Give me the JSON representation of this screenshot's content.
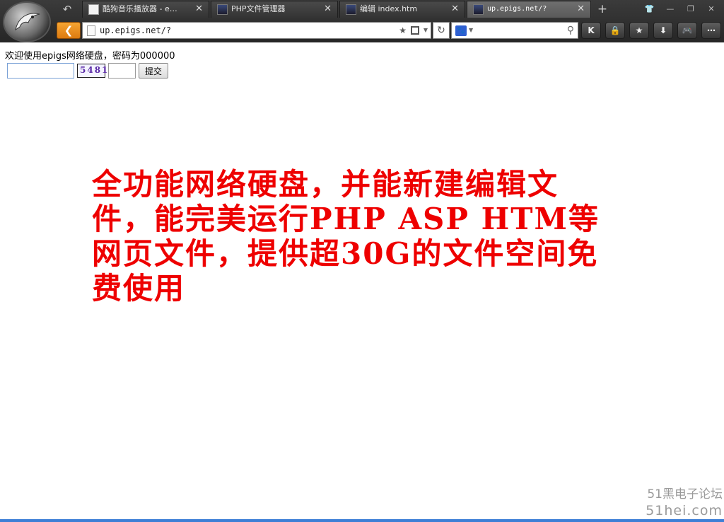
{
  "browser": {
    "tabs": [
      {
        "title": "酷狗音乐播放器 - e…",
        "icon": "document-icon",
        "active": false
      },
      {
        "title": "PHP文件管理器",
        "icon": "user-avatar-icon",
        "active": false
      },
      {
        "title": "编辑 index.htm",
        "icon": "user-avatar-icon",
        "active": false
      },
      {
        "title": "up.epigs.net/?",
        "icon": "user-avatar-icon",
        "active": true
      }
    ],
    "address": "up.epigs.net/?",
    "search_engine": "baidu-paw-icon",
    "toolbar_icons": [
      "k-icon",
      "lock-icon",
      "star-icon",
      "download-icon",
      "gamepad-icon",
      "more-icon"
    ],
    "accent_color": "#f39a1e"
  },
  "page": {
    "welcome": "欢迎使用epigs网络硬盘，密码为000000",
    "captcha_text": "5481",
    "submit_label": "提交",
    "promo_text": "全功能网络硬盘，并能新建编辑文件，能完美运行PHP ASP HTM等网页文件，提供超30G的文件空间免费使用",
    "promo_color": "#ee0000"
  },
  "watermark": {
    "line1": "51黑电子论坛",
    "line2": "51hei.com"
  }
}
